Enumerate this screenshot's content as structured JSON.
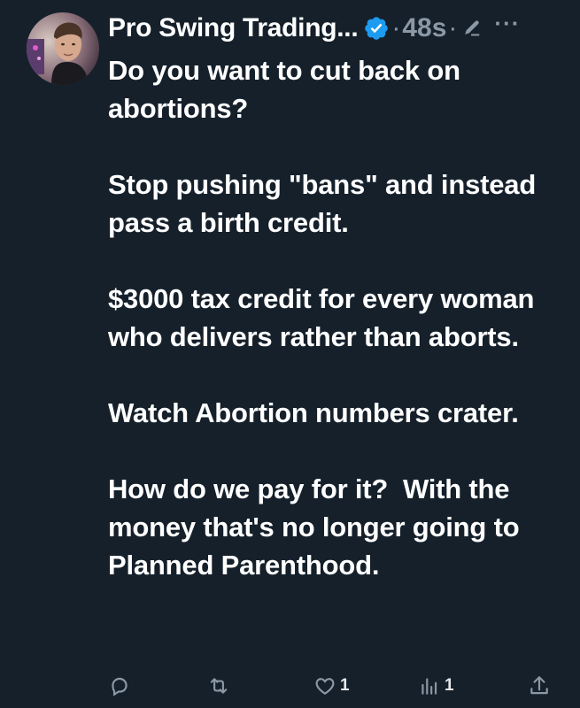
{
  "tweet": {
    "author_name": "Pro Swing Trading...",
    "separator_1": "·",
    "timestamp": "48s",
    "separator_2": "·",
    "more": "···",
    "paragraphs": [
      "Do you want to cut back on abortions?",
      "Stop pushing \"bans\" and instead pass a birth credit.",
      "$3000 tax credit for every woman who delivers rather than aborts.",
      "Watch Abortion numbers crater.",
      "How do we pay for it?  With the money that's no longer going to Planned Parenthood."
    ]
  },
  "actions": {
    "reply_count": "",
    "retweet_count": "",
    "like_count": "1",
    "views_count": "1"
  },
  "icons": {
    "verified": "verified-badge-icon",
    "edit": "edited-pencil-icon",
    "reply": "reply-icon",
    "retweet": "retweet-icon",
    "like": "heart-icon",
    "views": "analytics-icon",
    "share": "share-icon"
  },
  "colors": {
    "background": "#15202b",
    "text": "#ffffff",
    "secondary": "#8b98a5",
    "verified": "#1d9bf0"
  }
}
